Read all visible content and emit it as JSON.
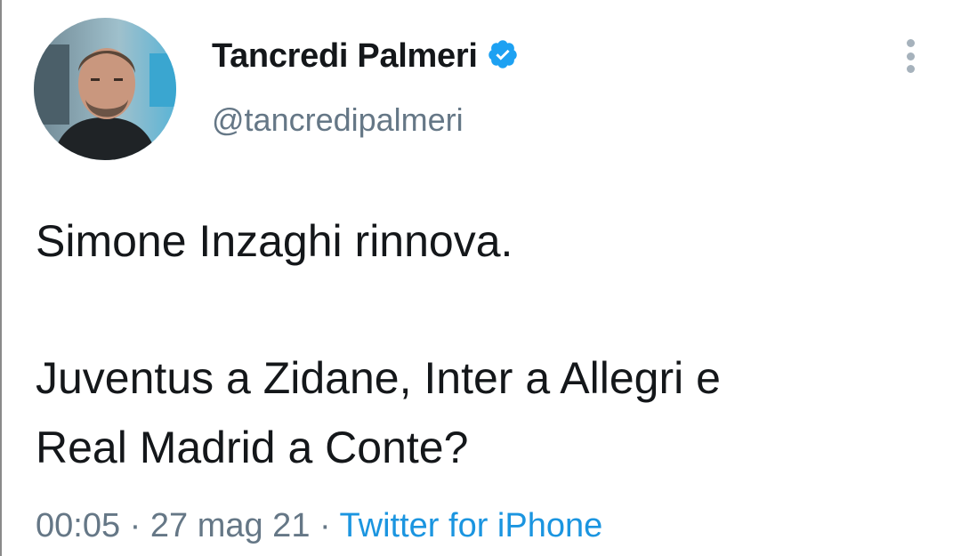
{
  "author": {
    "display_name": "Tancredi Palmeri",
    "handle": "@tancredipalmeri",
    "verified": true,
    "avatar_icon": "profile-photo"
  },
  "tweet": {
    "line1": "Simone Inzaghi rinnova.",
    "line2": "Juventus a Zidane, Inter a Allegri e",
    "line3": "Real Madrid a Conte?"
  },
  "meta": {
    "time": "00:05",
    "separator": "·",
    "date": "27 mag 21",
    "source": "Twitter for iPhone"
  },
  "colors": {
    "text": "#14171a",
    "secondary": "#657786",
    "accent": "#1b95e0",
    "verified": "#1da1f2"
  },
  "icons": {
    "verified": "verified-badge-icon",
    "more": "more-options-icon"
  }
}
